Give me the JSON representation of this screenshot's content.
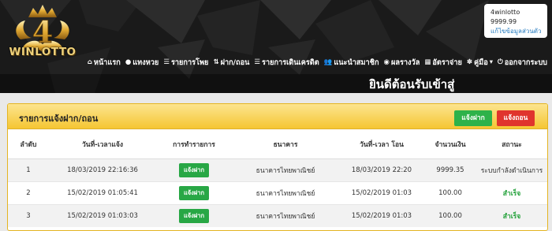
{
  "brand": {
    "logo_numeral": "4",
    "logo_text": "WINLOTTO"
  },
  "user": {
    "username": "4winlotto",
    "balance": "9999.99",
    "edit_profile_link": "แก้ไขข้อมูลส่วนตัว"
  },
  "nav": {
    "items": [
      {
        "label": "หน้าแรก",
        "icon": "home-icon"
      },
      {
        "label": "แทงหวย",
        "icon": "coin-icon"
      },
      {
        "label": "รายการโพย",
        "icon": "list-icon"
      },
      {
        "label": "ฝาก/ถอน",
        "icon": "transfer-icon"
      },
      {
        "label": "รายการเดินเครดิต",
        "icon": "credit-list-icon"
      },
      {
        "label": "แนะนำสมาชิก",
        "icon": "users-icon"
      },
      {
        "label": "ผลรางวัล",
        "icon": "eye-icon"
      },
      {
        "label": "อัตราจ่าย",
        "icon": "rate-icon"
      },
      {
        "label": "คู่มือ",
        "icon": "manual-icon"
      },
      {
        "label": "ออกจากระบบ",
        "icon": "power-icon"
      }
    ]
  },
  "welcome": "ยินดีต้อนรับเข้าสู่",
  "panel": {
    "title": "รายการแจ้งฝาก/ถอน",
    "deposit_button": "แจ้งฝาก",
    "withdraw_button": "แจ้งถอน"
  },
  "table": {
    "columns": [
      "ลำดับ",
      "วันที่-เวลาแจ้ง",
      "การทำรายการ",
      "ธนาคาร",
      "วันที่-เวลา โอน",
      "จำนวนเงิน",
      "สถานะ"
    ],
    "rows": [
      {
        "no": "1",
        "notify_time": "18/03/2019 22:16:36",
        "type": "แจ้งฝาก",
        "bank": "ธนาคารไทยพาณิชย์",
        "transfer_time": "18/03/2019 22:20",
        "amount": "9999.35",
        "status": "ระบบกำลังดำเนินการ"
      },
      {
        "no": "2",
        "notify_time": "15/02/2019 01:05:41",
        "type": "แจ้งฝาก",
        "bank": "ธนาคารไทยพาณิชย์",
        "transfer_time": "15/02/2019 01:03",
        "amount": "100.00",
        "status": "สำเร็จ"
      },
      {
        "no": "3",
        "notify_time": "15/02/2019 01:03:03",
        "type": "แจ้งฝาก",
        "bank": "ธนาคารไทยพาณิชย์",
        "transfer_time": "15/02/2019 01:03",
        "amount": "100.00",
        "status": "สำเร็จ"
      }
    ]
  },
  "colors": {
    "header_bg": "#1c1c1c",
    "panel_header": "#f5c632",
    "deposit": "#2eb24a",
    "withdraw": "#e0342d",
    "success": "#21a038",
    "gold": "#f0d27a"
  }
}
